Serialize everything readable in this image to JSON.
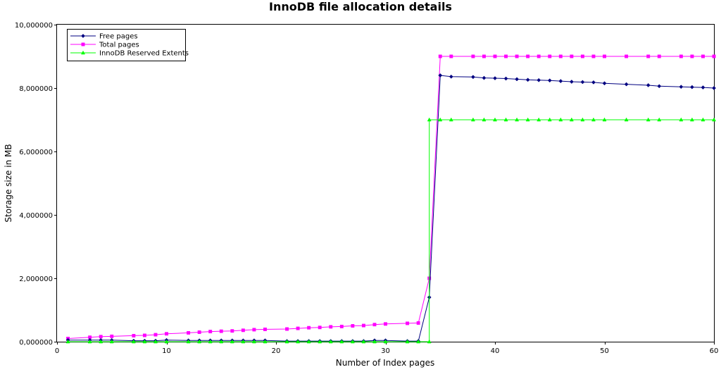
{
  "chart_data": {
    "type": "line",
    "title": "InnoDB file allocation details",
    "xlabel": "Number of Index pages",
    "ylabel": "Storage size in MB",
    "xlim": [
      0,
      60
    ],
    "ylim": [
      0,
      10
    ],
    "xticks": [
      0,
      10,
      20,
      30,
      40,
      50,
      60
    ],
    "yticks": [
      0,
      2,
      4,
      6,
      8,
      10
    ],
    "xtick_labels": [
      "0",
      "10",
      "20",
      "30",
      "40",
      "50",
      "60"
    ],
    "ytick_labels": [
      "0,000000",
      "2,000000",
      "4,000000",
      "6,000000",
      "8,000000",
      "10,000000"
    ],
    "grid": false,
    "legend_position": "top-left",
    "series": [
      {
        "name": "Free pages",
        "color": "#000080",
        "marker": "diamond",
        "x": [
          1,
          3,
          4,
          5,
          7,
          8,
          9,
          10,
          12,
          13,
          14,
          15,
          16,
          17,
          18,
          19,
          21,
          22,
          23,
          24,
          25,
          26,
          27,
          28,
          29,
          30,
          32,
          33,
          34,
          35,
          36,
          38,
          39,
          40,
          41,
          42,
          43,
          44,
          45,
          46,
          47,
          48,
          49,
          50,
          52,
          54,
          55,
          57,
          58,
          59,
          60
        ],
        "values": [
          0.05,
          0.05,
          0.05,
          0.05,
          0.03,
          0.03,
          0.03,
          0.05,
          0.04,
          0.04,
          0.04,
          0.04,
          0.04,
          0.04,
          0.04,
          0.04,
          0.02,
          0.02,
          0.02,
          0.02,
          0.02,
          0.02,
          0.02,
          0.02,
          0.04,
          0.04,
          0.02,
          0.02,
          1.4,
          8.4,
          8.36,
          8.35,
          8.32,
          8.31,
          8.3,
          8.28,
          8.26,
          8.25,
          8.24,
          8.22,
          8.2,
          8.19,
          8.18,
          8.15,
          8.12,
          8.09,
          8.06,
          8.04,
          8.03,
          8.02,
          8.0
        ]
      },
      {
        "name": "Total pages",
        "color": "#ff00ff",
        "marker": "square",
        "x": [
          1,
          3,
          4,
          5,
          7,
          8,
          9,
          10,
          12,
          13,
          14,
          15,
          16,
          17,
          18,
          19,
          21,
          22,
          23,
          24,
          25,
          26,
          27,
          28,
          29,
          30,
          32,
          33,
          34,
          35,
          36,
          38,
          39,
          40,
          41,
          42,
          43,
          44,
          45,
          46,
          47,
          48,
          49,
          50,
          52,
          54,
          55,
          57,
          58,
          59,
          60
        ],
        "values": [
          0.1,
          0.14,
          0.16,
          0.17,
          0.19,
          0.2,
          0.22,
          0.25,
          0.28,
          0.3,
          0.32,
          0.33,
          0.34,
          0.36,
          0.38,
          0.39,
          0.4,
          0.42,
          0.44,
          0.45,
          0.47,
          0.48,
          0.5,
          0.51,
          0.54,
          0.56,
          0.58,
          0.59,
          2.0,
          9.0,
          9.0,
          9.0,
          9.0,
          9.0,
          9.0,
          9.0,
          9.0,
          9.0,
          9.0,
          9.0,
          9.0,
          9.0,
          9.0,
          9.0,
          9.0,
          9.0,
          9.0,
          9.0,
          9.0,
          9.0,
          9.0
        ]
      },
      {
        "name": "InnoDB Reserved Extents",
        "color": "#00ff00",
        "marker": "triangle",
        "x": [
          1,
          3,
          4,
          5,
          7,
          8,
          9,
          10,
          12,
          13,
          14,
          15,
          16,
          17,
          18,
          19,
          21,
          22,
          23,
          24,
          25,
          26,
          27,
          28,
          29,
          30,
          32,
          33,
          34,
          34,
          35,
          36,
          38,
          39,
          40,
          41,
          42,
          43,
          44,
          45,
          46,
          47,
          48,
          49,
          50,
          52,
          54,
          55,
          57,
          58,
          59,
          60
        ],
        "values": [
          0,
          0,
          0,
          0,
          0,
          0,
          0,
          0,
          0,
          0,
          0,
          0,
          0,
          0,
          0,
          0,
          0,
          0,
          0,
          0,
          0,
          0,
          0,
          0,
          0,
          0,
          0,
          0,
          0,
          7.0,
          7.0,
          7.0,
          7.0,
          7.0,
          7.0,
          7.0,
          7.0,
          7.0,
          7.0,
          7.0,
          7.0,
          7.0,
          7.0,
          7.0,
          7.0,
          7.0,
          7.0,
          7.0,
          7.0,
          7.0,
          7.0,
          7.0
        ]
      }
    ]
  }
}
